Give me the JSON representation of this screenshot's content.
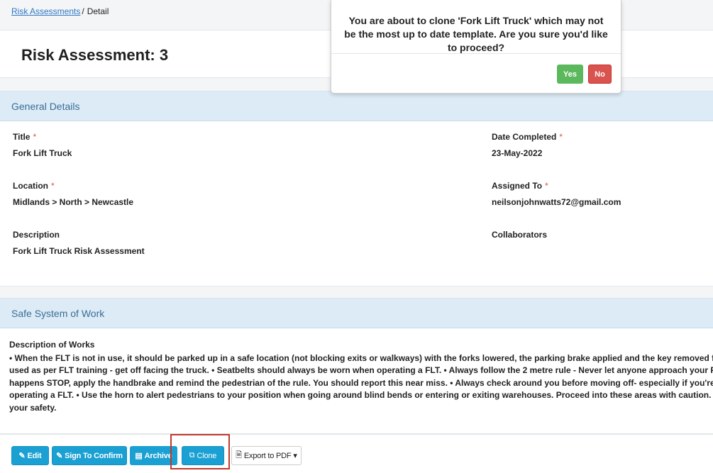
{
  "breadcrumb": {
    "link": "Risk Assessments",
    "separator": "/",
    "current": "Detail"
  },
  "page_title": "Risk Assessment: 3",
  "general": {
    "header": "General Details",
    "title_label": "Title",
    "title_value": "Fork Lift Truck",
    "date_label": "Date Completed",
    "date_value": "23-May-2022",
    "location_label": "Location",
    "location_value": "Midlands > North > Newcastle",
    "assigned_label": "Assigned To",
    "assigned_value": "neilsonjohnwatts72@gmail.com",
    "description_label": "Description",
    "description_value": "Fork Lift Truck Risk Assessment",
    "collaborators_label": "Collaborators",
    "required_marker": "*"
  },
  "safe_system": {
    "header": "Safe System of Work",
    "desc_label": "Description of Works",
    "lines": [
      "• When the FLT is not in use, it should be parked up in a safe location (not blocking exits or walkways) with the forks lowered, the parking brake applied and the key removed from the ignition (and not on display",
      "used as per FLT training - get off facing the truck. • Seatbelts should always be worn when operating a FLT. • Always follow the 2 metre rule - Never let anyone approach your FLT until you have applied your handb",
      "happens STOP, apply the handbrake and remind the pedestrian of the rule. You should report this near miss. • Always check around you before moving off- especially if you're reversing. • Always look in the direc",
      "operating a FLT. • Use the horn to alert pedestrians to your position when going around blind bends or entering or exiting warehouses. Proceed into these areas with caution. • Never turn the FLT when the load is",
      "your safety."
    ]
  },
  "buttons": {
    "edit": "Edit",
    "sign": "Sign To Confirm",
    "archive": "Archive",
    "clone": "Clone",
    "export": "Export to PDF"
  },
  "modal": {
    "message": "You are about to clone 'Fork Lift Truck' which may not be the most up to date template. Are you sure you'd like to proceed?",
    "yes": "Yes",
    "no": "No"
  },
  "colors": {
    "primary": "#1aa0d2",
    "success": "#5cb85c",
    "danger": "#d9534f",
    "section_header": "#dcebf6",
    "highlight": "#c0392b"
  }
}
